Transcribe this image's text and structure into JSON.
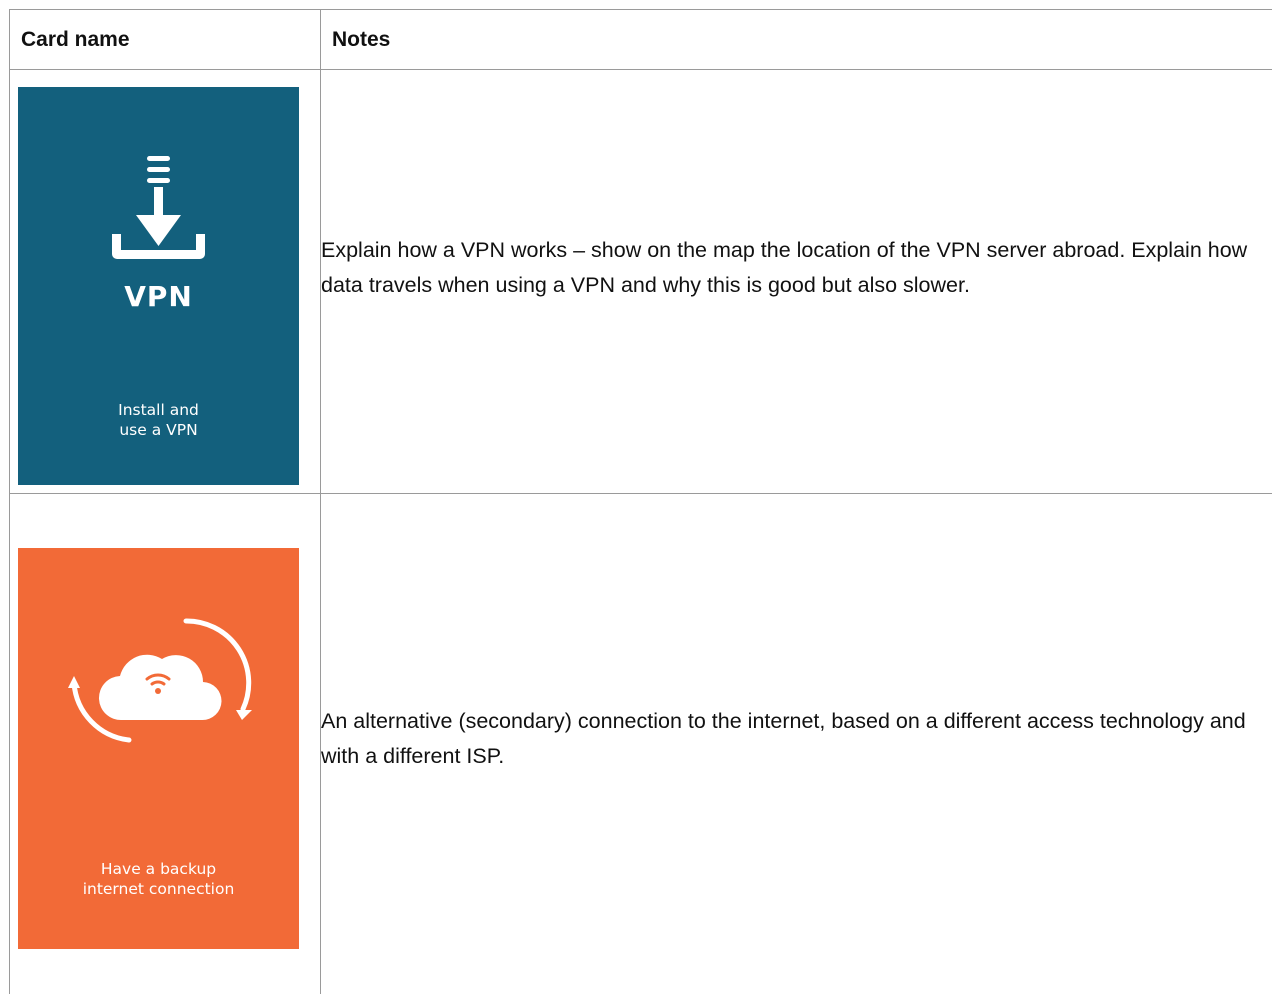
{
  "table": {
    "headers": {
      "card_name": "Card name",
      "notes": "Notes"
    },
    "rows": [
      {
        "card": {
          "label_line1": "Install and",
          "label_line2": "use a VPN",
          "badge_text": "VPN",
          "background": "#13607d",
          "icon": "download-vpn-icon"
        },
        "notes": "Explain how a VPN works – show on the map the location of the VPN server abroad. Explain how data travels when using a VPN and why this is good but also slower."
      },
      {
        "card": {
          "label_line1": "Have a backup",
          "label_line2": "internet connection",
          "background": "#f26a37",
          "icon": "cloud-sync-wifi-icon"
        },
        "notes": "An alternative (secondary) connection to the internet, based on a different access technology and with a different ISP."
      }
    ]
  }
}
